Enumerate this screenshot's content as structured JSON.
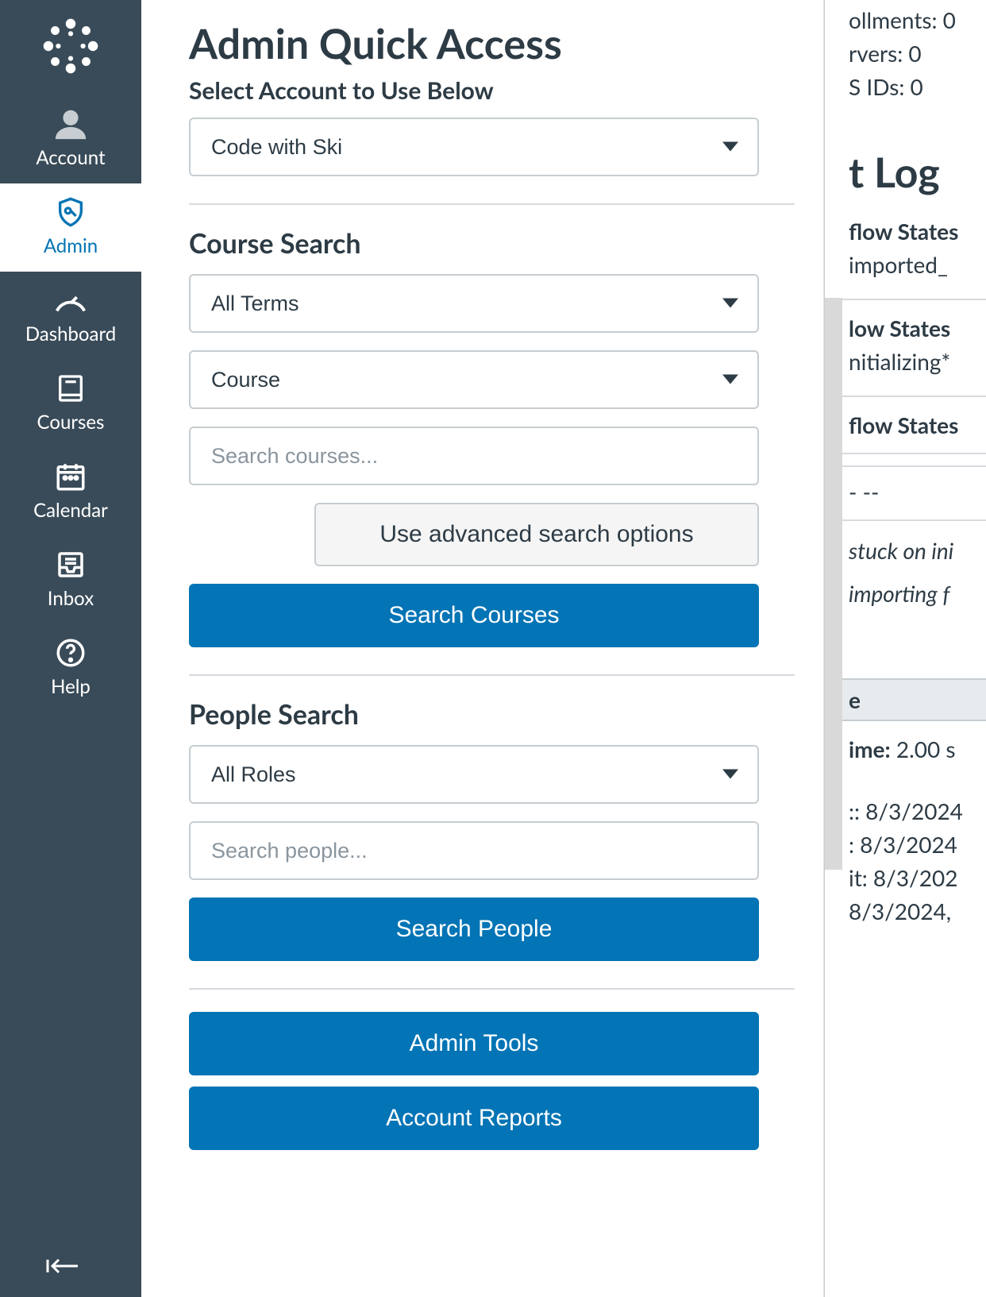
{
  "nav": {
    "items": [
      {
        "label": "Account"
      },
      {
        "label": "Admin"
      },
      {
        "label": "Dashboard"
      },
      {
        "label": "Courses"
      },
      {
        "label": "Calendar"
      },
      {
        "label": "Inbox"
      },
      {
        "label": "Help"
      }
    ]
  },
  "tray": {
    "title": "Admin Quick Access",
    "subtitle": "Select Account to Use Below",
    "account_select": "Code with Ski",
    "course_search": {
      "heading": "Course Search",
      "term_select": "All Terms",
      "type_select": "Course",
      "search_placeholder": "Search courses...",
      "advanced_btn": "Use advanced search options",
      "submit_btn": "Search Courses"
    },
    "people_search": {
      "heading": "People Search",
      "role_select": "All Roles",
      "search_placeholder": "Search people...",
      "submit_btn": "Search People"
    },
    "admin_tools_btn": "Admin Tools",
    "account_reports_btn": "Account Reports"
  },
  "right": {
    "stat1": "ollments: 0",
    "stat2": "rvers: 0",
    "stat3": "S IDs: 0",
    "log_heading": "t Log",
    "flow1_h": "flow States",
    "flow1_v": "imported_",
    "flow2_h": "low States",
    "flow2_v": "nitializing*",
    "flow3_h": "flow States",
    "dash": "-  --",
    "note1": "stuck on ini",
    "note2": "importing f",
    "band": "e",
    "time_label": "ime:",
    "time_value": " 2.00 s",
    "d1": ":: 8/3/2024",
    "d2": ": 8/3/2024",
    "d3": "it: 8/3/202",
    "d4": "8/3/2024,"
  }
}
